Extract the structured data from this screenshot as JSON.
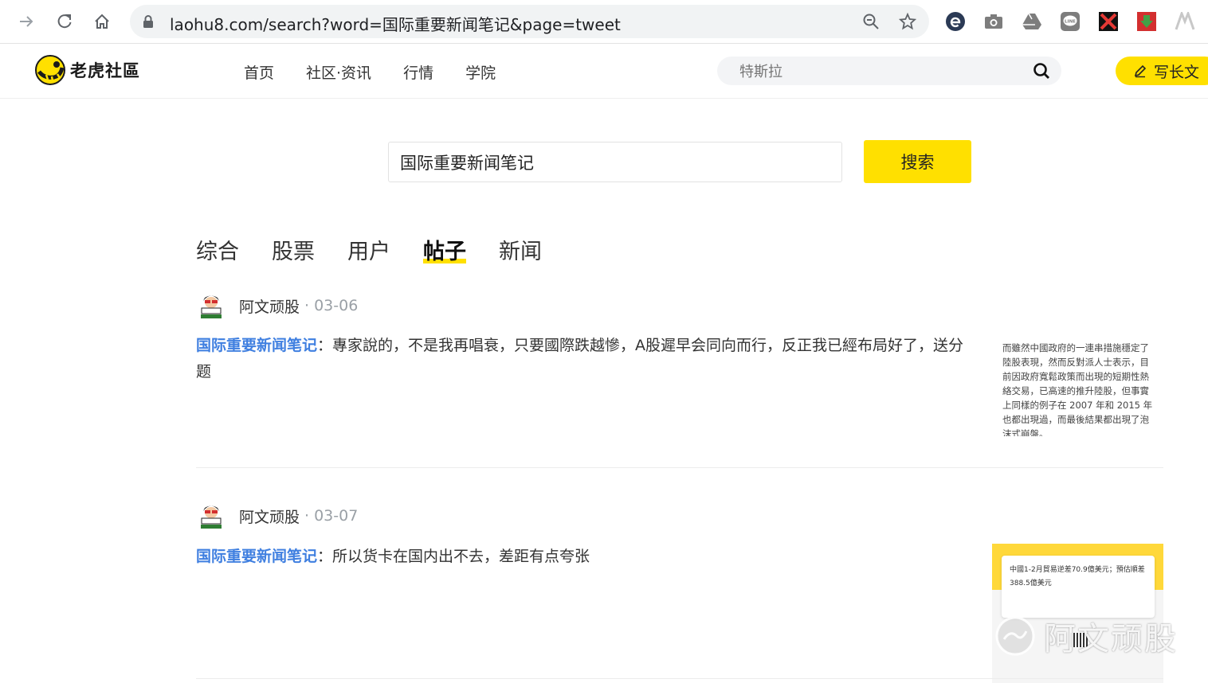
{
  "browser": {
    "url": "laohu8.com/search?word=国际重要新闻笔记&page=tweet",
    "extensions": [
      "edge-icon",
      "camera-icon",
      "drive-icon",
      "line-icon",
      "x-extension-icon",
      "download-extension-icon",
      "vector-icon"
    ]
  },
  "header": {
    "logo_text": "老虎社區",
    "nav": [
      "首页",
      "社区·资讯",
      "行情",
      "学院"
    ],
    "search_placeholder": "特斯拉",
    "write_label": "写长文"
  },
  "search": {
    "query": "国际重要新闻笔记",
    "button_label": "搜索"
  },
  "tabs": [
    {
      "label": "综合",
      "active": false
    },
    {
      "label": "股票",
      "active": false
    },
    {
      "label": "用户",
      "active": false
    },
    {
      "label": "帖子",
      "active": true
    },
    {
      "label": "新闻",
      "active": false
    }
  ],
  "posts": [
    {
      "author": "阿文顽股",
      "date": "· 03-06",
      "keyword": "国际重要新闻笔记",
      "text": "：專家說的，不是我再唱衰，只要國際跌越慘，A股遲早会同向而行，反正我已經布局好了，送分题",
      "thumb_text": "而雖然中國政府的一連串措施穩定了陸股表現，然而反對派人士表示，目前因政府寬鬆政策而出現的短期性熱絡交易，已高速的推升陸股，但事實上同樣的例子在 2007 年和 2015 年也都出現過，而最後結果都出現了泡沫式崩盤。"
    },
    {
      "author": "阿文顽股",
      "date": "· 03-07",
      "keyword": "国际重要新闻笔记",
      "text": "：所以货卡在国内出不去，差距有点夸张",
      "thumb_text": "中國1-2月貿易逆差70.9億美元；預估順差388.5億美元"
    }
  ],
  "watermark": "阿文顽股",
  "colors": {
    "accent": "#ffe000",
    "keyword": "#3f7fe0",
    "date": "#9aa0a6"
  }
}
